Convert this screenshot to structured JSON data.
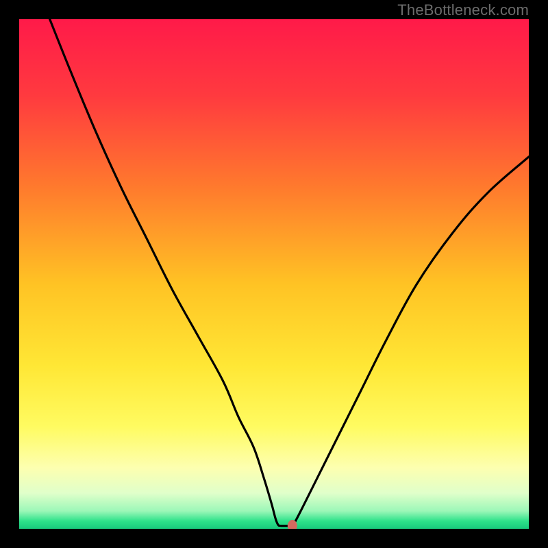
{
  "watermark": "TheBottleneck.com",
  "chart_data": {
    "type": "line",
    "title": "",
    "xlabel": "",
    "ylabel": "",
    "xlim": [
      0,
      100
    ],
    "ylim": [
      0,
      100
    ],
    "curve_points": [
      [
        6,
        100
      ],
      [
        10,
        90
      ],
      [
        15,
        78
      ],
      [
        20,
        67
      ],
      [
        25,
        57
      ],
      [
        30,
        47
      ],
      [
        35,
        38
      ],
      [
        40,
        29
      ],
      [
        43,
        22
      ],
      [
        46,
        16
      ],
      [
        48,
        10
      ],
      [
        49.5,
        5
      ],
      [
        50.3,
        2.0
      ],
      [
        50.8,
        0.8
      ],
      [
        51.3,
        0.6
      ],
      [
        53.0,
        0.6
      ],
      [
        53.6,
        0.6
      ],
      [
        54.2,
        1.5
      ],
      [
        55.5,
        4
      ],
      [
        58,
        9
      ],
      [
        62,
        17
      ],
      [
        67,
        27
      ],
      [
        72,
        37
      ],
      [
        78,
        48
      ],
      [
        85,
        58
      ],
      [
        92,
        66
      ],
      [
        100,
        73
      ]
    ],
    "marker": {
      "x": 53.6,
      "y": 0.6,
      "color": "#d46a5f"
    },
    "gradient_stops": [
      {
        "offset": 0.0,
        "color": "#ff1a49"
      },
      {
        "offset": 0.15,
        "color": "#ff3a3f"
      },
      {
        "offset": 0.33,
        "color": "#ff7a2d"
      },
      {
        "offset": 0.52,
        "color": "#ffc324"
      },
      {
        "offset": 0.68,
        "color": "#ffe735"
      },
      {
        "offset": 0.8,
        "color": "#fffb61"
      },
      {
        "offset": 0.88,
        "color": "#fdffb0"
      },
      {
        "offset": 0.93,
        "color": "#e0ffca"
      },
      {
        "offset": 0.965,
        "color": "#9cf7b8"
      },
      {
        "offset": 0.985,
        "color": "#2de28a"
      },
      {
        "offset": 1.0,
        "color": "#18c97c"
      }
    ]
  }
}
